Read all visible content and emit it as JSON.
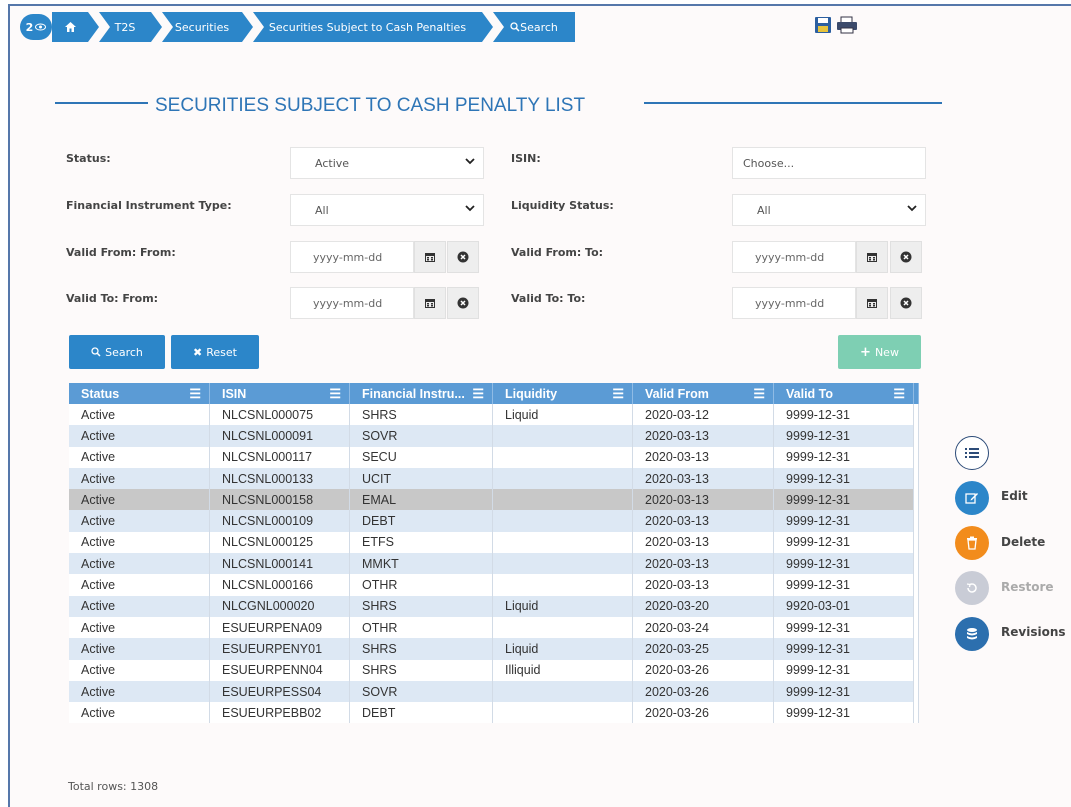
{
  "breadcrumb": {
    "badge": "2",
    "items": [
      "T2S",
      "Securities",
      "Securities Subject to Cash Penalties",
      "Search"
    ]
  },
  "page_title": "SECURITIES SUBJECT TO CASH PENALTY LIST",
  "form": {
    "status": {
      "label": "Status:",
      "value": "Active"
    },
    "isin": {
      "label": "ISIN:",
      "placeholder": "Choose..."
    },
    "fin_type": {
      "label": "Financial Instrument Type:",
      "value": "All"
    },
    "liquidity": {
      "label": "Liquidity Status:",
      "value": "All"
    },
    "vf_from": {
      "label": "Valid From: From:",
      "placeholder": "yyyy-mm-dd"
    },
    "vf_to": {
      "label": "Valid From: To:",
      "placeholder": "yyyy-mm-dd"
    },
    "vt_from": {
      "label": "Valid To: From:",
      "placeholder": "yyyy-mm-dd"
    },
    "vt_to": {
      "label": "Valid To: To:",
      "placeholder": "yyyy-mm-dd"
    }
  },
  "buttons": {
    "search": "Search",
    "reset": "Reset",
    "new": "New"
  },
  "table": {
    "columns": [
      "Status",
      "ISIN",
      "Financial Instru...",
      "Liquidity",
      "Valid From",
      "Valid To"
    ],
    "rows": [
      [
        "Active",
        "NLCSNL000075",
        "SHRS",
        "Liquid",
        "2020-03-12",
        "9999-12-31"
      ],
      [
        "Active",
        "NLCSNL000091",
        "SOVR",
        "",
        "2020-03-13",
        "9999-12-31"
      ],
      [
        "Active",
        "NLCSNL000117",
        "SECU",
        "",
        "2020-03-13",
        "9999-12-31"
      ],
      [
        "Active",
        "NLCSNL000133",
        "UCIT",
        "",
        "2020-03-13",
        "9999-12-31"
      ],
      [
        "Active",
        "NLCSNL000158",
        "EMAL",
        "",
        "2020-03-13",
        "9999-12-31"
      ],
      [
        "Active",
        "NLCSNL000109",
        "DEBT",
        "",
        "2020-03-13",
        "9999-12-31"
      ],
      [
        "Active",
        "NLCSNL000125",
        "ETFS",
        "",
        "2020-03-13",
        "9999-12-31"
      ],
      [
        "Active",
        "NLCSNL000141",
        "MMKT",
        "",
        "2020-03-13",
        "9999-12-31"
      ],
      [
        "Active",
        "NLCSNL000166",
        "OTHR",
        "",
        "2020-03-13",
        "9999-12-31"
      ],
      [
        "Active",
        "NLCGNL000020",
        "SHRS",
        "Liquid",
        "2020-03-20",
        "9920-03-01"
      ],
      [
        "Active",
        "ESUEURPENA09",
        "OTHR",
        "",
        "2020-03-24",
        "9999-12-31"
      ],
      [
        "Active",
        "ESUEURPENY01",
        "SHRS",
        "Liquid",
        "2020-03-25",
        "9999-12-31"
      ],
      [
        "Active",
        "ESUEURPENN04",
        "SHRS",
        "Illiquid",
        "2020-03-26",
        "9999-12-31"
      ],
      [
        "Active",
        "ESUEURPESS04",
        "SOVR",
        "",
        "2020-03-26",
        "9999-12-31"
      ],
      [
        "Active",
        "ESUEURPEBB02",
        "DEBT",
        "",
        "2020-03-26",
        "9999-12-31"
      ]
    ],
    "selected_row": 4
  },
  "total_rows": "Total rows: 1308",
  "actions": {
    "edit": "Edit",
    "delete": "Delete",
    "restore": "Restore",
    "revisions": "Revisions"
  },
  "colors": {
    "primary": "#2c86c9",
    "header": "#5b9bd5",
    "new_button": "#7ecfb3",
    "delete": "#f28c1c",
    "revisions": "#2c6fae",
    "restore": "#c9ccd6"
  }
}
